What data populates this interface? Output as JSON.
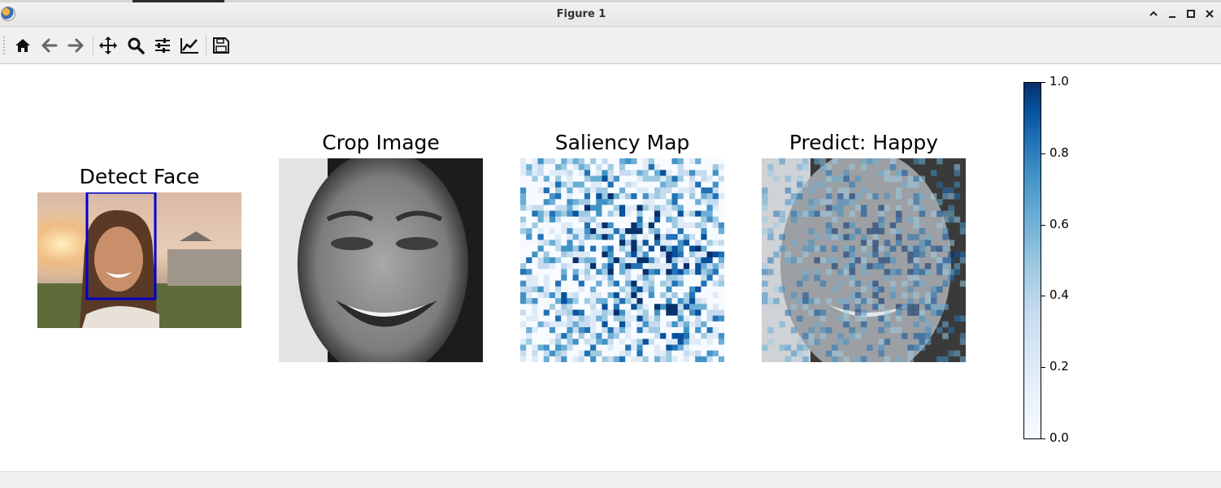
{
  "window": {
    "title": "Figure 1",
    "controls": [
      "chevron-up-icon",
      "minimize-icon",
      "maximize-icon",
      "close-icon"
    ]
  },
  "toolbar": {
    "buttons": [
      {
        "name": "home",
        "icon": "home-icon"
      },
      {
        "name": "back",
        "icon": "arrow-left-icon"
      },
      {
        "name": "forward",
        "icon": "arrow-right-icon"
      },
      {
        "name": "pan",
        "icon": "move-icon"
      },
      {
        "name": "zoom",
        "icon": "magnifier-icon"
      },
      {
        "name": "subplots",
        "icon": "sliders-icon"
      },
      {
        "name": "customize",
        "icon": "line-chart-icon"
      },
      {
        "name": "save",
        "icon": "floppy-disk-icon"
      }
    ]
  },
  "figure": {
    "panels": [
      {
        "title": "Detect Face",
        "kind": "photo-with-box",
        "box_color": "#0000cc"
      },
      {
        "title": "Crop Image",
        "kind": "grayscale-face"
      },
      {
        "title": "Saliency Map",
        "kind": "heatmap",
        "cmap": "Blues"
      },
      {
        "title": "Predict: Happy",
        "kind": "overlay",
        "cmap": "Blues"
      }
    ],
    "colorbar": {
      "cmap": "Blues",
      "range": [
        0.0,
        1.0
      ],
      "ticks": [
        "0.0",
        "0.2",
        "0.4",
        "0.6",
        "0.8",
        "1.0"
      ],
      "color_low": "#f7fbff",
      "color_high": "#08306b"
    }
  },
  "chart_data": {
    "type": "heatmap",
    "title": "Saliency Map",
    "colorbar_range": [
      0.0,
      1.0
    ],
    "colorbar_ticks": [
      0.0,
      0.2,
      0.4,
      0.6,
      0.8,
      1.0
    ],
    "colormap": "Blues"
  }
}
